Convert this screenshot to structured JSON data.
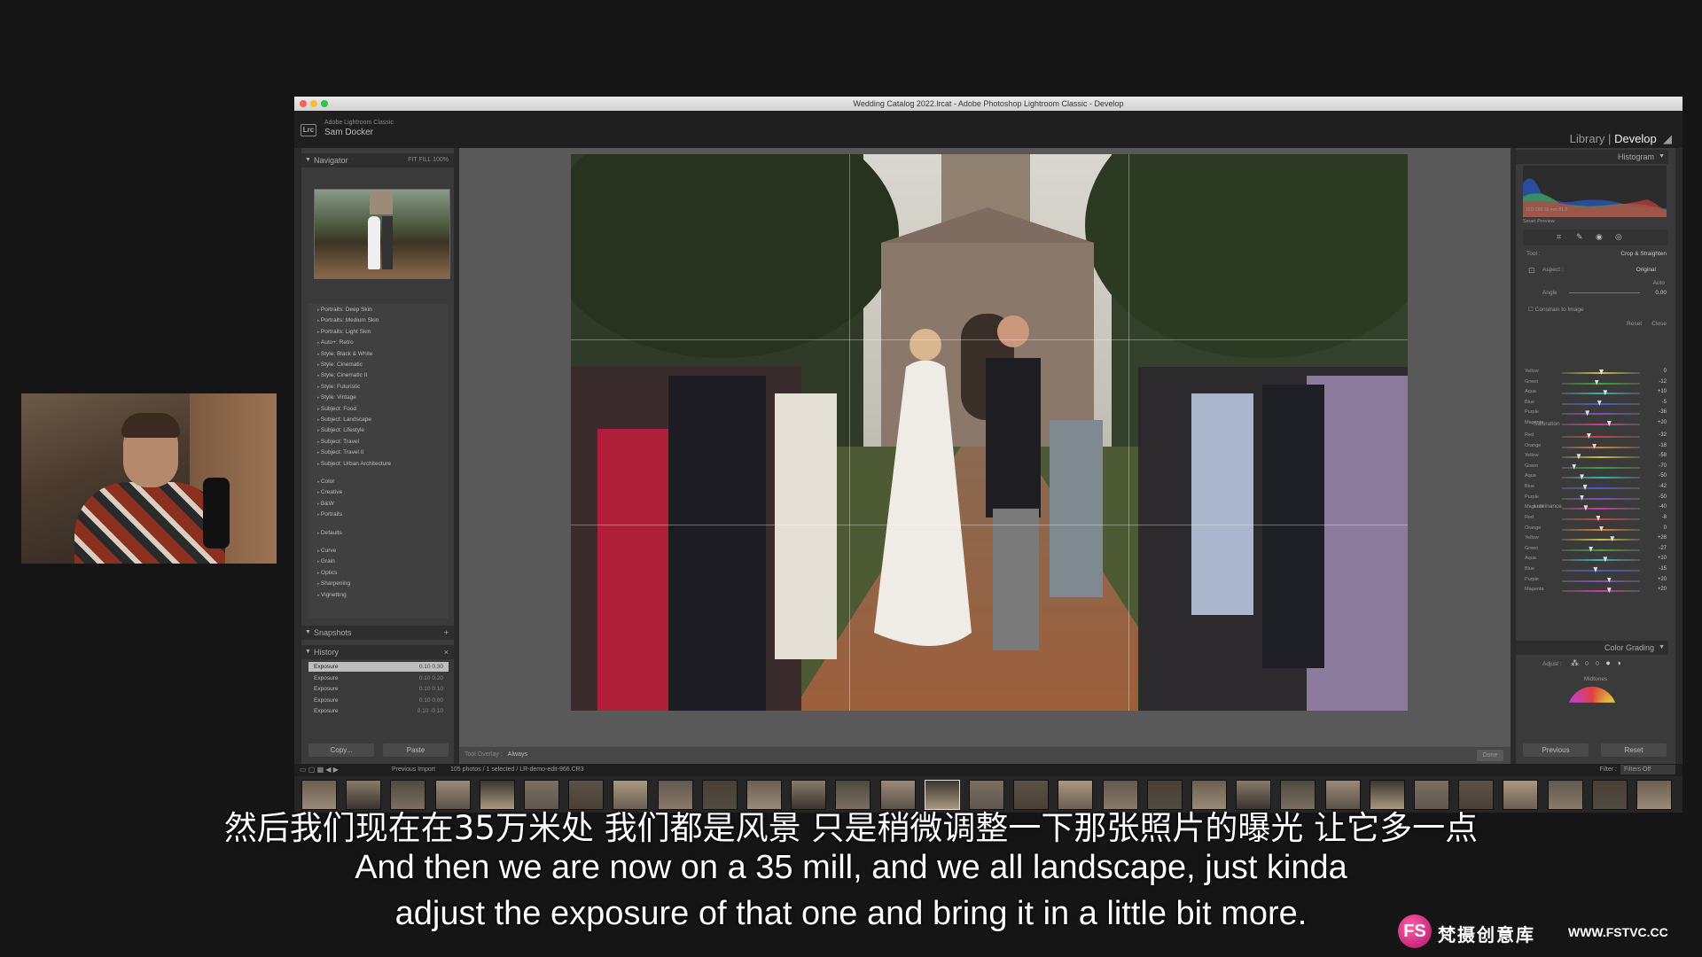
{
  "window": {
    "title": "Wedding Catalog 2022.lrcat - Adobe Photoshop Lightroom Classic - Develop"
  },
  "identity": {
    "app_label": "Adobe Lightroom Classic",
    "user": "Sam Docker",
    "logo": "Lrc"
  },
  "modules": {
    "library": "Library",
    "separator": "|",
    "develop": "Develop"
  },
  "navigator": {
    "title": "Navigator",
    "zoom": "FIT  FILL  100%"
  },
  "presets": [
    "Portraits: Deep Skin",
    "Portraits: Medium Skin",
    "Portraits: Light Skin",
    "Auto+: Retro",
    "Style: Black & White",
    "Style: Cinematic",
    "Style: Cinematic II",
    "Style: Futuristic",
    "Style: Vintage",
    "Subject: Food",
    "Subject: Landscape",
    "Subject: Lifestyle",
    "Subject: Travel",
    "Subject: Travel II",
    "Subject: Urban Architecture",
    "Color",
    "Creative",
    "B&W",
    "Portraits",
    "Defaults",
    "Curve",
    "Grain",
    "Optics",
    "Sharpening",
    "Vignetting"
  ],
  "snapshots": {
    "title": "Snapshots"
  },
  "history": {
    "title": "History",
    "items": [
      {
        "label": "Exposure",
        "a": "0.10",
        "b": "0.30"
      },
      {
        "label": "Exposure",
        "a": "0.10",
        "b": "0.20"
      },
      {
        "label": "Exposure",
        "a": "0.10",
        "b": "0.10"
      },
      {
        "label": "Exposure",
        "a": "0.10",
        "b": "0.00"
      },
      {
        "label": "Exposure",
        "a": "0.10",
        "b": "-0.10"
      }
    ]
  },
  "left_buttons": {
    "copy": "Copy...",
    "paste": "Paste"
  },
  "toolbar": {
    "overlay_label": "Tool Overlay :",
    "overlay_value": "Always",
    "done": "Done"
  },
  "histogram": {
    "title": "Histogram",
    "info": "ISO 200    35 mm    f/1.8",
    "smart_preview": "Smart Preview"
  },
  "crop": {
    "tool_label": "Tool :",
    "tool_name": "Crop & Straighten",
    "aspect_label": "Aspect :",
    "aspect_value": "Original",
    "angle_label": "Angle",
    "auto": "Auto",
    "angle_value": "0.00",
    "constrain": "Constrain to Image",
    "reset": "Reset",
    "close": "Close"
  },
  "hue_sliders": [
    {
      "label": "Yellow",
      "value": "0"
    },
    {
      "label": "Green",
      "value": "-12"
    },
    {
      "label": "Aqua",
      "value": "+10"
    },
    {
      "label": "Blue",
      "value": "-5"
    },
    {
      "label": "Purple",
      "value": "-36"
    },
    {
      "label": "Magenta",
      "value": "+20"
    }
  ],
  "saturation": {
    "title": "Saturation",
    "sliders": [
      {
        "label": "Red",
        "value": "-32"
      },
      {
        "label": "Orange",
        "value": "-18"
      },
      {
        "label": "Yellow",
        "value": "-58"
      },
      {
        "label": "Green",
        "value": "-70"
      },
      {
        "label": "Aqua",
        "value": "-50"
      },
      {
        "label": "Blue",
        "value": "-42"
      },
      {
        "label": "Purple",
        "value": "-50"
      },
      {
        "label": "Magenta",
        "value": "-40"
      }
    ]
  },
  "luminance": {
    "title": "Luminance",
    "sliders": [
      {
        "label": "Red",
        "value": "-8"
      },
      {
        "label": "Orange",
        "value": "0"
      },
      {
        "label": "Yellow",
        "value": "+28"
      },
      {
        "label": "Green",
        "value": "-27"
      },
      {
        "label": "Aqua",
        "value": "+10"
      },
      {
        "label": "Blue",
        "value": "-15"
      },
      {
        "label": "Purple",
        "value": "+20"
      },
      {
        "label": "Magenta",
        "value": "+20"
      }
    ]
  },
  "color_grading": {
    "title": "Color Grading",
    "adjust": "Adjust :",
    "midtones": "Midtones"
  },
  "right_buttons": {
    "previous": "Previous",
    "reset": "Reset"
  },
  "filmbar": {
    "source": "Previous Import",
    "count": "105 photos / 1 selected / LR-demo-edit-966.CR3",
    "filter_label": "Filter :",
    "filter_value": "Filters Off"
  },
  "subtitles": {
    "zh": "然后我们现在在35万米处 我们都是风景 只是稍微调整一下那张照片的曝光 让它多一点",
    "en_line1": "And then we are now on a 35 mill, and we all landscape, just kinda",
    "en_line2": "adjust the exposure of that one and bring it in a little bit more."
  },
  "watermark": {
    "logo": "FS",
    "name": "梵摄创意库",
    "url": "WWW.FSTVC.CC"
  },
  "colors": {
    "accent_pink": "#d4147a",
    "panel": "#3a3a3a",
    "canvas": "#595959"
  }
}
